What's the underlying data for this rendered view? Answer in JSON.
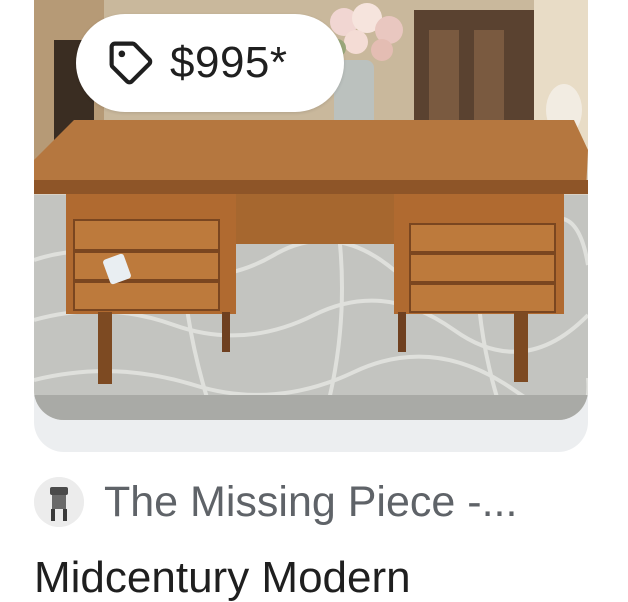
{
  "listing": {
    "price": "$995*",
    "source_name": "The Missing Piece -...",
    "title": "Midcentury Modern",
    "image": "teak-desk-photo"
  },
  "icons": {
    "price_tag": "tag-icon",
    "favicon": "store-logo-icon"
  },
  "colors": {
    "card_bg": "#eceef0",
    "price_text": "#1f1f1f",
    "source_text": "#5f6368"
  }
}
